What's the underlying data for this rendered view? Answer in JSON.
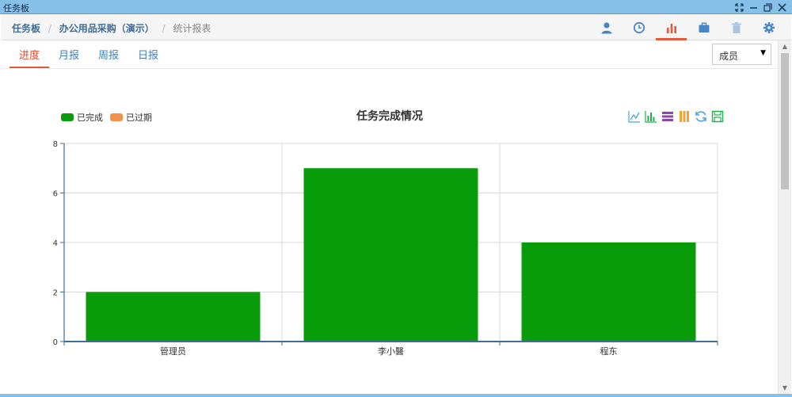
{
  "window": {
    "title": "任务板"
  },
  "breadcrumb": {
    "items": [
      "任务板",
      "办公用品采购（演示）"
    ],
    "current": "统计报表"
  },
  "toolbar": {
    "icons": [
      "user-icon",
      "clock-icon",
      "bar-chart-icon",
      "briefcase-icon",
      "trash-icon",
      "gear-icon"
    ],
    "active": "bar-chart-icon"
  },
  "tabs": {
    "items": [
      "进度",
      "月报",
      "周报",
      "日报"
    ],
    "active": "进度"
  },
  "member_select": {
    "value": "成员"
  },
  "chart_tools": [
    "line-chart-icon",
    "bar-chart-icon",
    "stack-icon",
    "tile-icon",
    "refresh-icon",
    "save-icon"
  ],
  "colors": {
    "accent": "#e25a3c",
    "done": "#089c0b",
    "overdue": "#f4924b",
    "link": "#3f7fb8"
  },
  "chart_data": {
    "type": "bar",
    "title": "任务完成情况",
    "categories": [
      "管理员",
      "李小醫",
      "程东"
    ],
    "series": [
      {
        "name": "已完成",
        "values": [
          2,
          7,
          4
        ],
        "color": "#089c0b"
      },
      {
        "name": "已过期",
        "values": [
          0,
          0,
          0
        ],
        "color": "#f4924b"
      }
    ],
    "yticks": [
      "0",
      "2",
      "4",
      "6",
      "8"
    ],
    "ylim": [
      0,
      8
    ],
    "grid": true,
    "legend": "top-left"
  }
}
